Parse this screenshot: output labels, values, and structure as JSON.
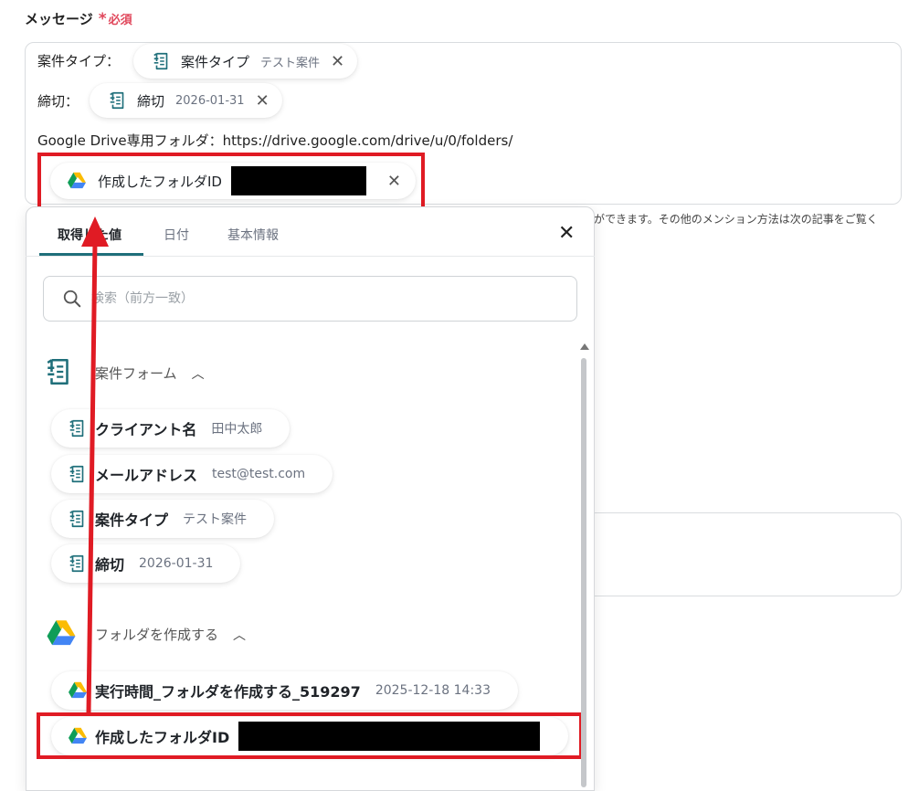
{
  "field": {
    "label": "メッセージ",
    "required_star": "*",
    "required_text": "必須"
  },
  "message": {
    "line1_prefix": "案件タイプ：",
    "line2_prefix": "締切：",
    "line3_text": "Google Drive専用フォルダ：https://drive.google.com/drive/u/0/folders/",
    "pill_type": {
      "label": "案件タイプ",
      "value": "テスト案件"
    },
    "pill_deadline": {
      "label": "締切",
      "value": "2026-01-31"
    },
    "pill_folder": {
      "label": "作成したフォルダID"
    },
    "close_glyph": "✕"
  },
  "hint": "ができます。その他のメンション方法は次の記事をご覧く",
  "panel": {
    "tabs": [
      {
        "label": "取得した値",
        "active": true
      },
      {
        "label": "日付"
      },
      {
        "label": "基本情報"
      }
    ],
    "close_glyph": "✕",
    "search_placeholder": "検索（前方一致）",
    "section_form": {
      "title": "案件フォーム",
      "items": [
        {
          "label": "クライアント名",
          "value": "田中太郎"
        },
        {
          "label": "メールアドレス",
          "value": "test@test.com"
        },
        {
          "label": "案件タイプ",
          "value": "テスト案件"
        },
        {
          "label": "締切",
          "value": "2026-01-31"
        }
      ]
    },
    "section_drive": {
      "title": "フォルダを作成する",
      "items": [
        {
          "label": "実行時間_フォルダを作成する_519297",
          "value": "2025-12-18 14:33"
        },
        {
          "label": "作成したフォルダID"
        }
      ]
    },
    "chevron_glyph": "︿"
  },
  "colors": {
    "form_icon": "#1f6f7a",
    "required": "#e0475b",
    "highlight": "#e01b24"
  }
}
